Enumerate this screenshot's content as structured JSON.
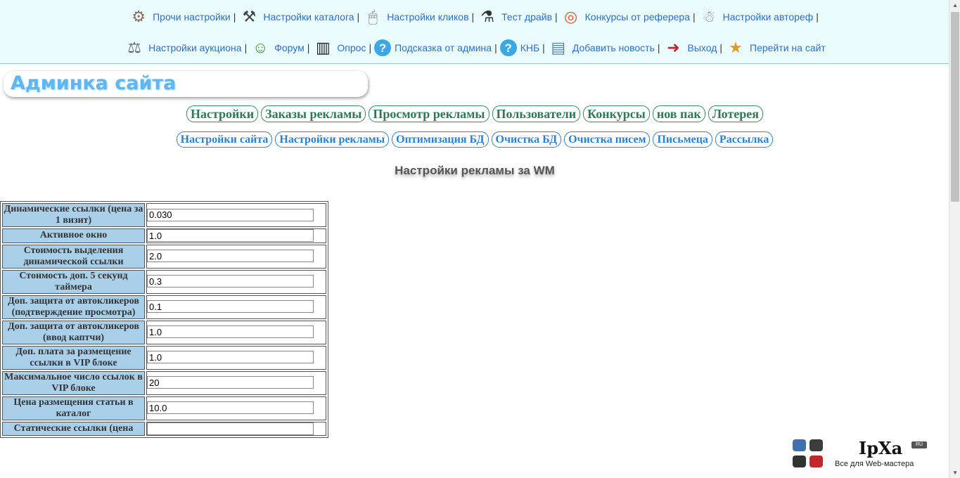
{
  "topnav": {
    "row1": [
      {
        "label": "Прочи настройки",
        "icon": "gears-icon"
      },
      {
        "label": "Настройки каталога",
        "icon": "tools-icon"
      },
      {
        "label": "Настройки кликов",
        "icon": "mouse-icon"
      },
      {
        "label": "Тест драйв",
        "icon": "flask-icon"
      },
      {
        "label": "Конкурсы от реферера",
        "icon": "target-icon"
      },
      {
        "label": "Настройки автореф",
        "icon": "robot-icon"
      }
    ],
    "row2": [
      {
        "label": "Настройки аукциона",
        "icon": "gavel-icon"
      },
      {
        "label": "Форум",
        "icon": "forum-icon"
      },
      {
        "label": "Опрос",
        "icon": "poll-icon"
      },
      {
        "label": "Подсказка от админа",
        "icon": "help-icon"
      },
      {
        "label": "КНБ",
        "icon": "help-icon"
      },
      {
        "label": "Добавить новость",
        "icon": "news-icon"
      },
      {
        "label": "Выход",
        "icon": "exit-icon"
      },
      {
        "label": "Перейти на сайт",
        "icon": "runner-icon"
      }
    ],
    "separator": "|"
  },
  "banner": {
    "title": "Админка сайта"
  },
  "main_tabs": [
    "Настройки",
    "Заказы рекламы",
    "Просмотр рекламы",
    "Пользователи",
    "Конкурсы",
    "нов пак",
    "Лотерея"
  ],
  "sub_tabs": [
    "Настройки сайта",
    "Настройки рекламы",
    "Оптимизация БД",
    "Очистка БД",
    "Очистка писем",
    "Письмеца",
    "Рассылка"
  ],
  "section_title": "Настройки рекламы за WM",
  "settings": [
    {
      "label": "Динамические ссылки (цена за 1 визит)",
      "value": "0.030"
    },
    {
      "label": "Активное окно",
      "value": "1.0"
    },
    {
      "label": "Стоимость выделения динамической ссылки",
      "value": "2.0"
    },
    {
      "label": "Стоимость доп. 5 секунд таймера",
      "value": "0.3"
    },
    {
      "label": "Доп. защита от автокликеров (подтверждение просмотра)",
      "value": "0.1"
    },
    {
      "label": "Доп. защита от автокликеров (ввод каптчи)",
      "value": "1.0"
    },
    {
      "label": "Доп. плата за размещение ссылки в VIP блоке",
      "value": "1.0"
    },
    {
      "label": "Максимальное число ссылок в VIP блоке",
      "value": "20"
    },
    {
      "label": "Цена размещения статьи в каталог",
      "value": "10.0"
    },
    {
      "label": "Статические ссылки (цена",
      "value": ""
    }
  ],
  "logo": {
    "text": "IpXa",
    "badge": "RU",
    "tagline": "Все для Web-мастера"
  }
}
